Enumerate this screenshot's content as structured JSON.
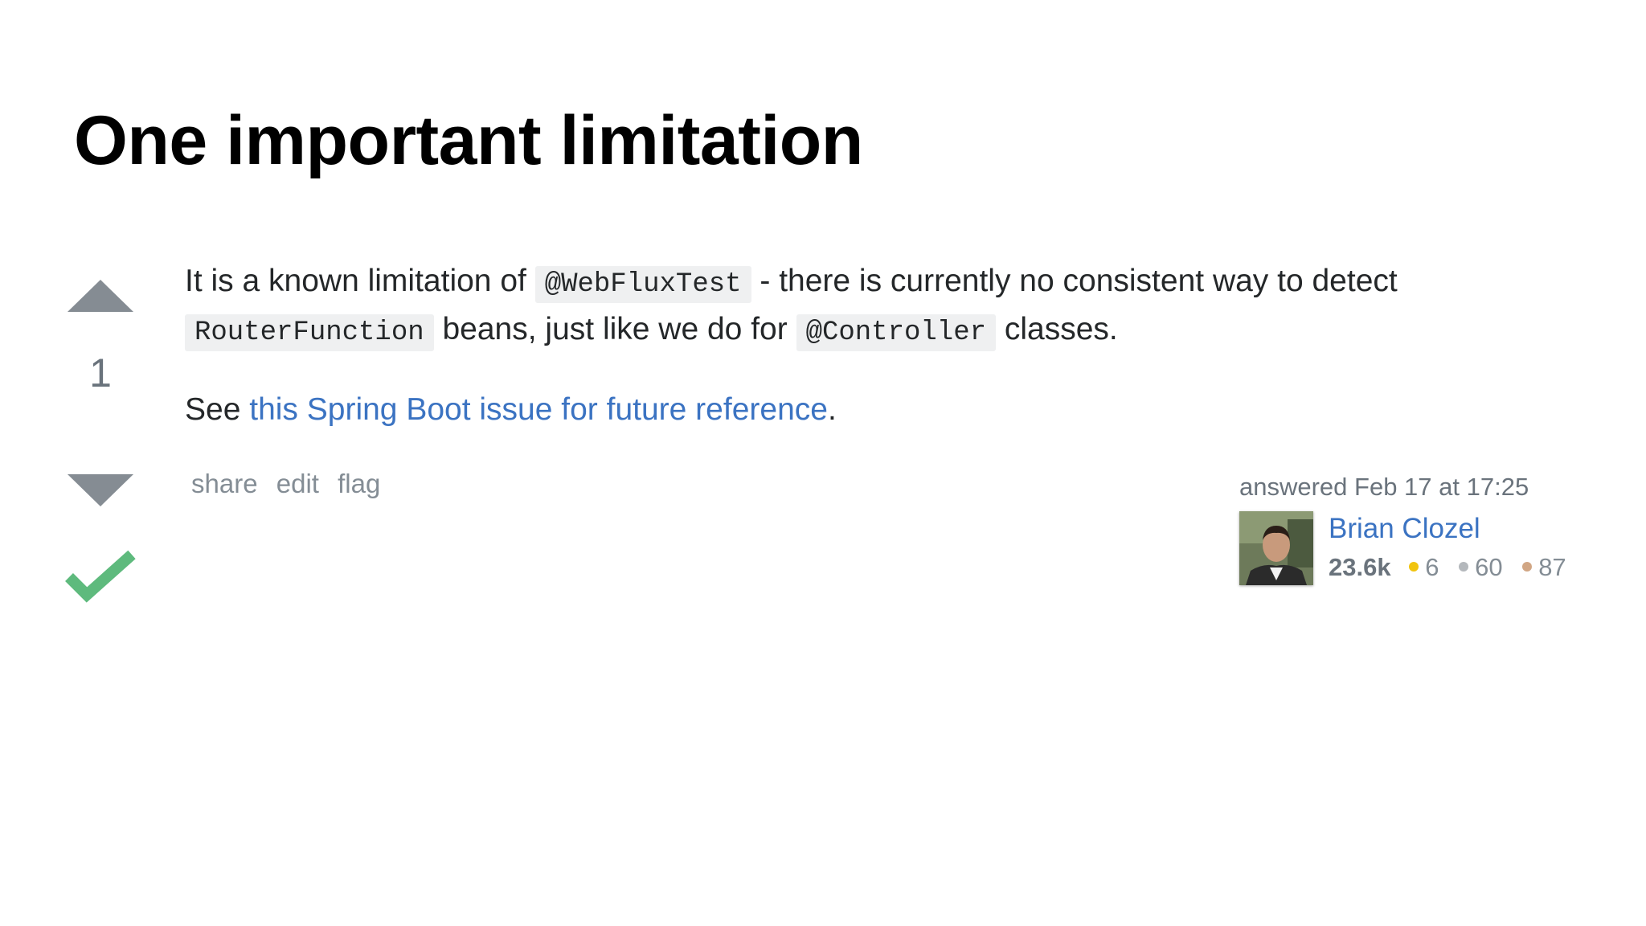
{
  "slide": {
    "title": "One important limitation"
  },
  "answer": {
    "vote_count": "1",
    "accepted": true,
    "paragraph1": {
      "t1": "It is a known limitation of ",
      "code1": "@WebFluxTest",
      "t2": " - there is currently no consistent way to detect ",
      "code2": "RouterFunction",
      "t3": " beans, just like we do for ",
      "code3": "@Controller",
      "t4": " classes."
    },
    "paragraph2": {
      "t1": "See ",
      "link": "this Spring Boot issue for future reference",
      "t2": "."
    },
    "menu": [
      "share",
      "edit",
      "flag"
    ],
    "signature": {
      "action_time": "answered Feb 17 at 17:25",
      "user_name": "Brian Clozel",
      "reputation": "23.6k",
      "badges": [
        {
          "count": "6",
          "color": "#f1c40f"
        },
        {
          "count": "60",
          "color": "#b4b8bc"
        },
        {
          "count": "87",
          "color": "#d1a684"
        }
      ]
    }
  },
  "colors": {
    "arrow": "#858c93",
    "accepted": "#5eba7d",
    "link": "#3b73c2"
  }
}
